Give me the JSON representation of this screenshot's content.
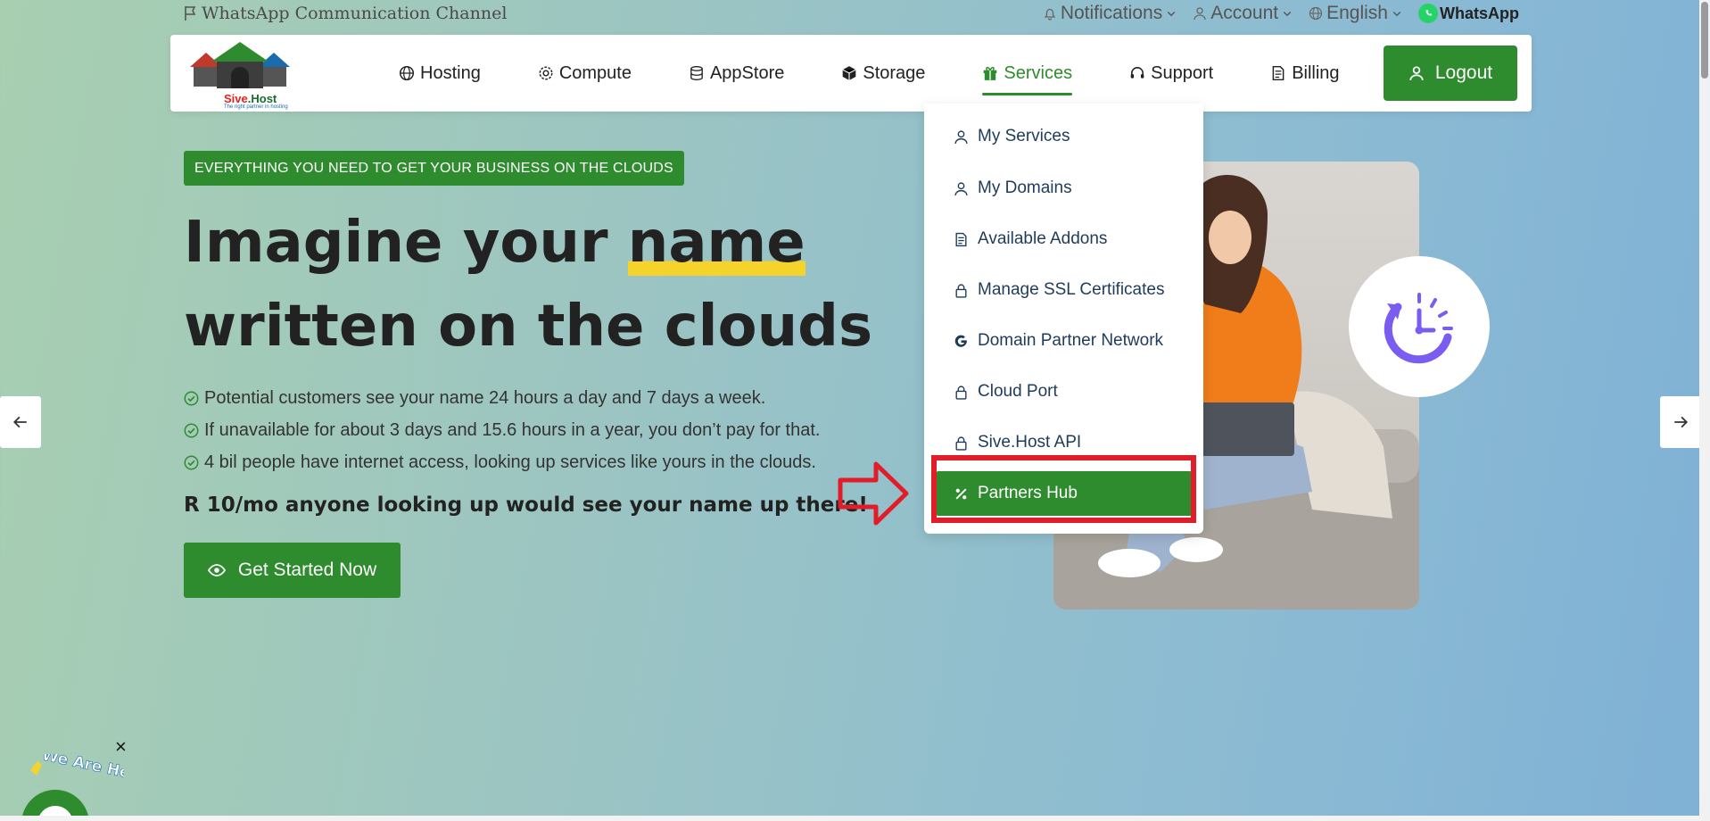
{
  "utility": {
    "channel": "WhatsApp Communication Channel",
    "notifications": "Notifications",
    "account": "Account",
    "language": "English",
    "whatsapp": "WhatsApp"
  },
  "logo": {
    "name_a": "Sive",
    "name_b": "Host",
    "tagline": "The right partner in hosting"
  },
  "nav": {
    "items": [
      {
        "label": "Hosting",
        "icon": "globe-icon"
      },
      {
        "label": "Compute",
        "icon": "gear-icon"
      },
      {
        "label": "AppStore",
        "icon": "database-icon"
      },
      {
        "label": "Storage",
        "icon": "box-icon"
      },
      {
        "label": "Services",
        "icon": "gift-icon",
        "active": true
      },
      {
        "label": "Support",
        "icon": "headset-icon"
      },
      {
        "label": "Billing",
        "icon": "document-icon"
      }
    ],
    "logout": "Logout"
  },
  "dropdown": {
    "items": [
      {
        "label": "My Services",
        "icon": "user-icon"
      },
      {
        "label": "My Domains",
        "icon": "user-icon"
      },
      {
        "label": "Available Addons",
        "icon": "document-icon"
      },
      {
        "label": "Manage SSL Certificates",
        "icon": "lock-icon"
      },
      {
        "label": "Domain Partner Network",
        "icon": "google-icon"
      },
      {
        "label": "Cloud Port",
        "icon": "lock-icon"
      },
      {
        "label": "Sive.Host API",
        "icon": "lock-icon"
      },
      {
        "label": "Partners Hub",
        "icon": "percent-icon",
        "active": true
      }
    ]
  },
  "hero": {
    "badge": "EVERYTHING YOU NEED TO GET YOUR BUSINESS ON THE CLOUDS",
    "title_a": "Imagine your ",
    "title_highlight": "name",
    "title_b": "written on the clouds",
    "features": [
      "Potential customers see your name 24 hours a day and 7 days a week.",
      "If unavailable for about 3 days and 15.6 hours in a year, you don’t pay for that.",
      "4 bil people have internet access, looking up services like yours in the clouds."
    ],
    "price": "R 10/mo anyone looking up would see your name up there!",
    "cta": "Get Started Now"
  },
  "chat": {
    "text": "We Are He",
    "close": "×"
  },
  "colors": {
    "brand_green": "#2e8b2e",
    "highlight_red": "#e11d2a",
    "accent_yellow": "#f6d32b",
    "clock_purple": "#7b5cf0"
  }
}
